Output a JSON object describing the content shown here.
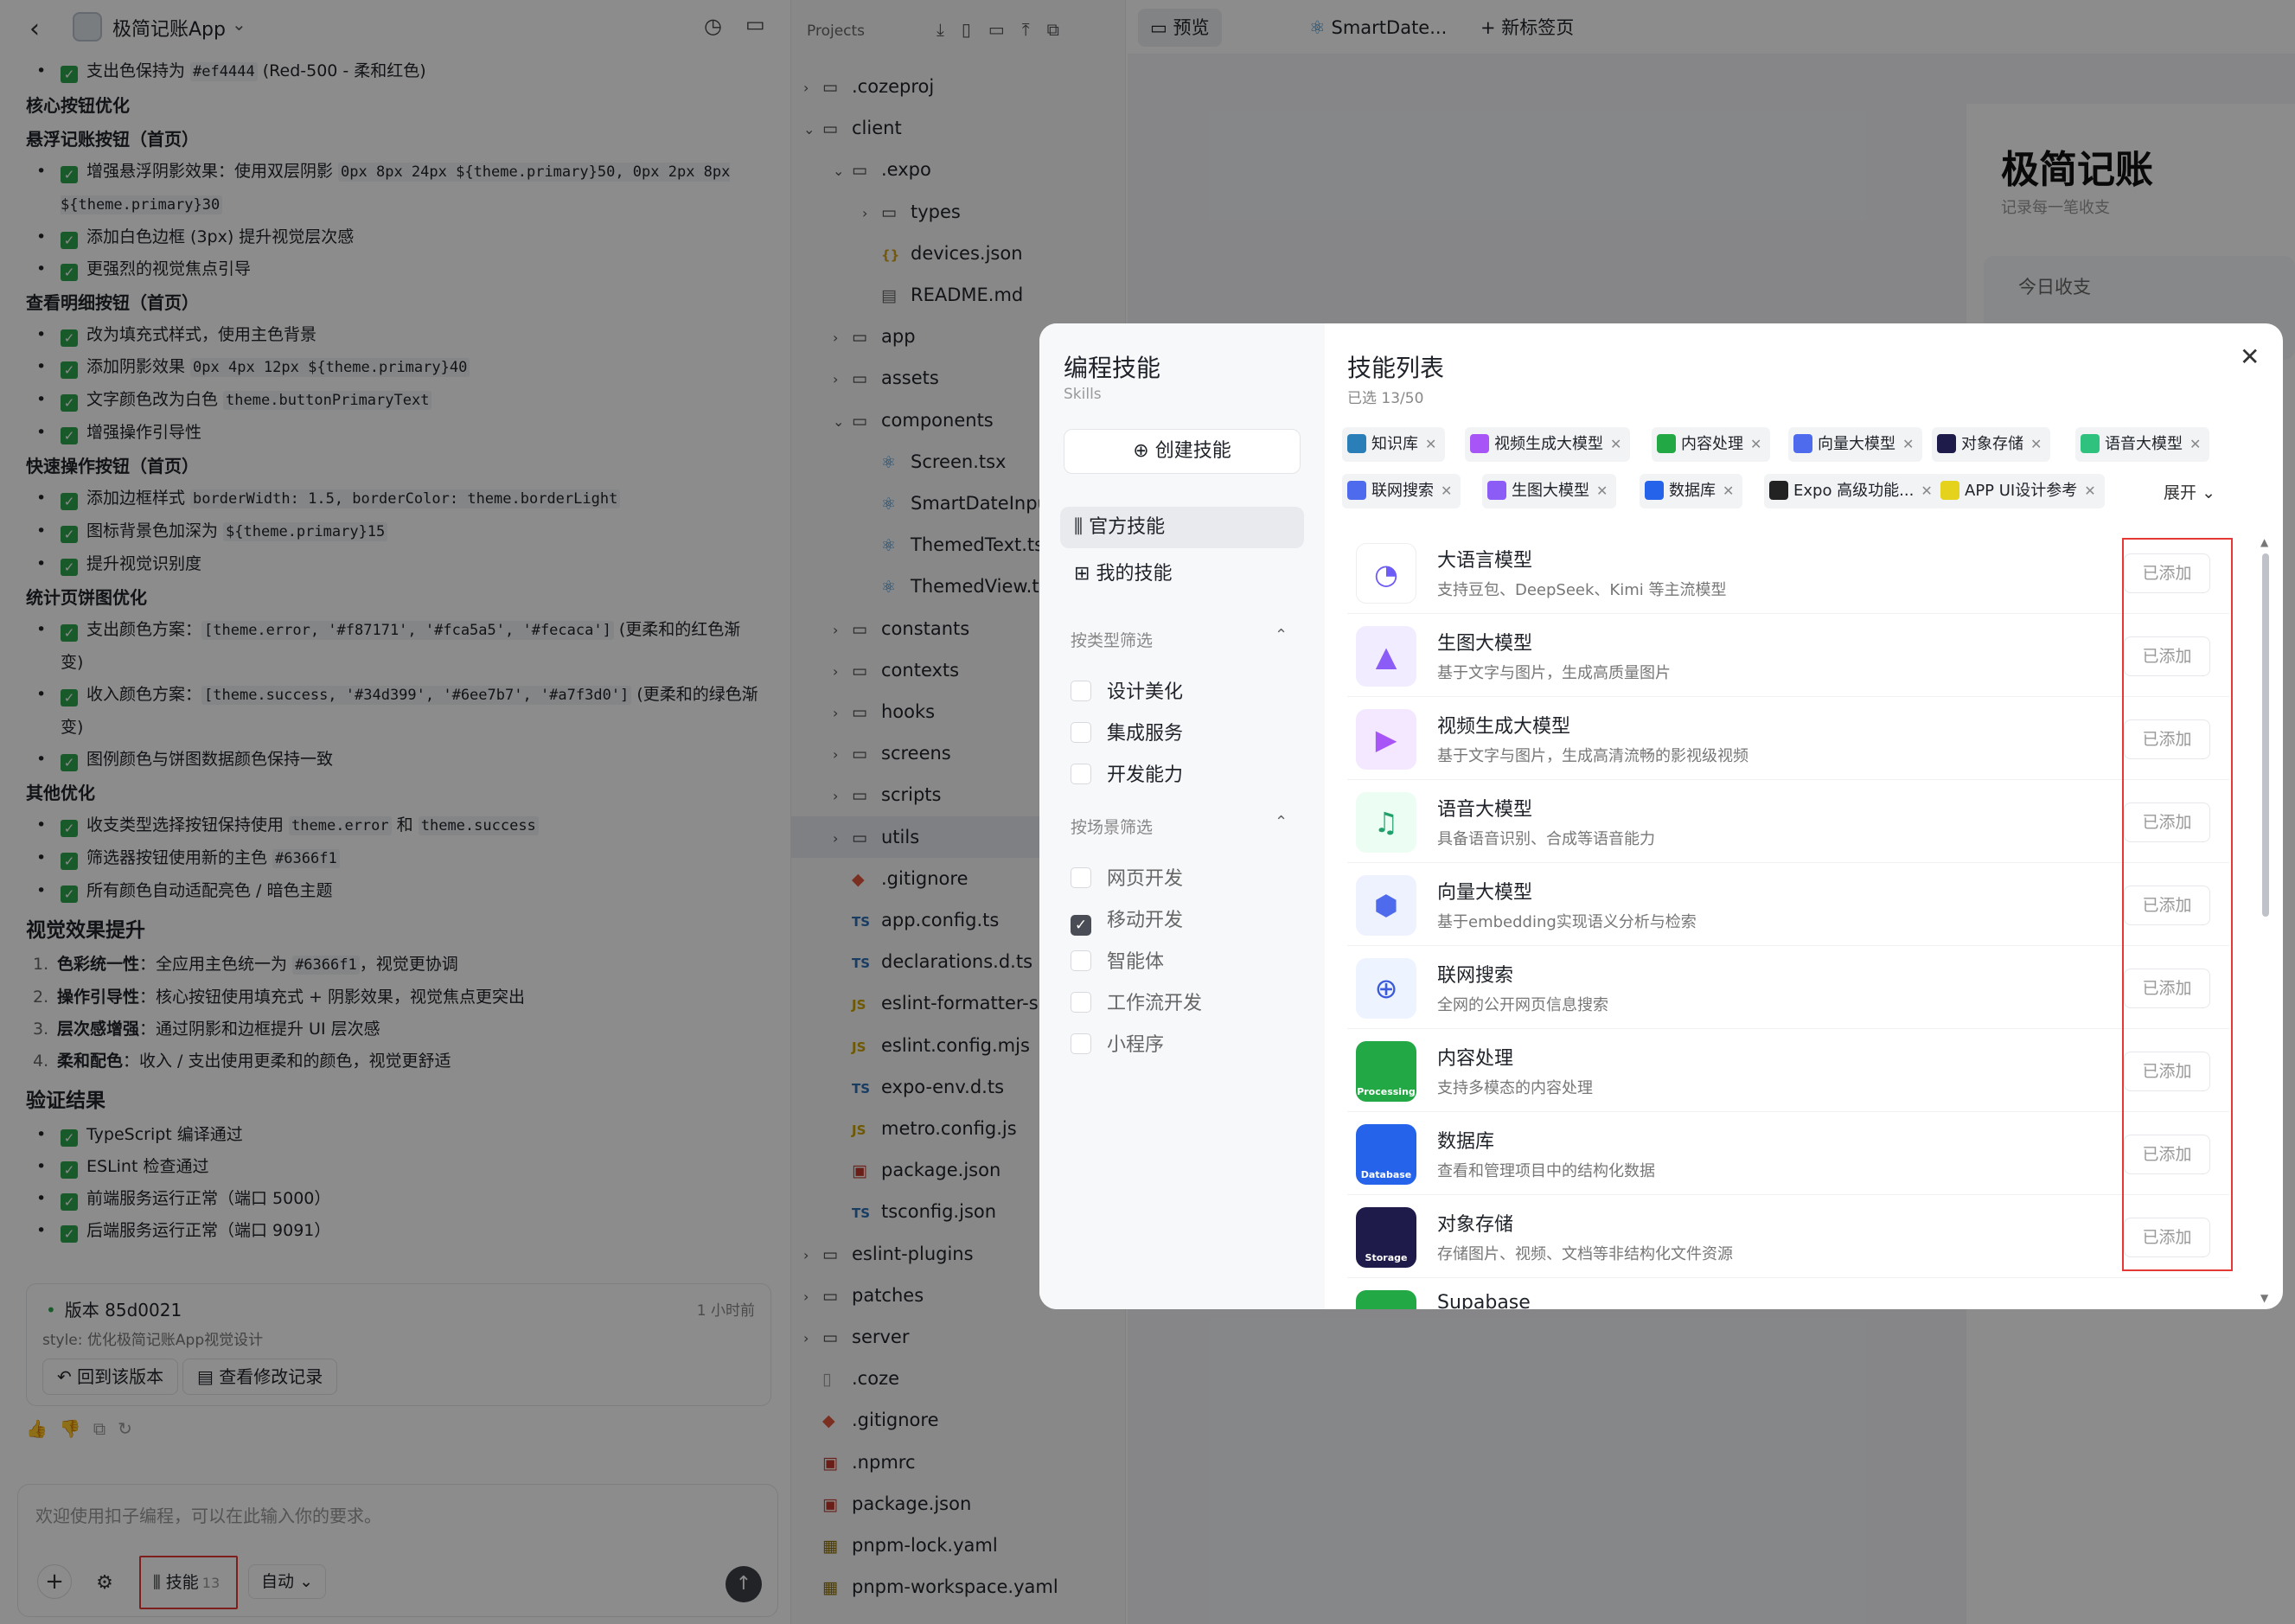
{
  "chat": {
    "app_title": "极简记账App",
    "sections": [
      {
        "type": "li",
        "text_before": "支出色保持为 ",
        "code": "#ef4444",
        "text_after": " (Red-500 - 柔和红色)"
      },
      {
        "type": "h4",
        "text": "核心按钮优化"
      },
      {
        "type": "h4",
        "text": "悬浮记账按钮（首页）"
      },
      {
        "type": "li",
        "text_before": "增强悬浮阴影效果：使用双层阴影 ",
        "code": "0px 8px 24px ${theme.primary}50, 0px 2px 8px ${theme.primary}30",
        "text_after": ""
      },
      {
        "type": "li",
        "text_before": "添加白色边框 (3px) 提升视觉层次感",
        "code": "",
        "text_after": ""
      },
      {
        "type": "li",
        "text_before": "更强烈的视觉焦点引导",
        "code": "",
        "text_after": ""
      },
      {
        "type": "h4",
        "text": "查看明细按钮（首页）"
      },
      {
        "type": "li",
        "text_before": "改为填充式样式，使用主色背景",
        "code": "",
        "text_after": ""
      },
      {
        "type": "li",
        "text_before": "添加阴影效果 ",
        "code": "0px 4px 12px ${theme.primary}40",
        "text_after": ""
      },
      {
        "type": "li",
        "text_before": "文字颜色改为白色 ",
        "code": "theme.buttonPrimaryText",
        "text_after": ""
      },
      {
        "type": "li",
        "text_before": "增强操作引导性",
        "code": "",
        "text_after": ""
      },
      {
        "type": "h4",
        "text": "快速操作按钮（首页）"
      },
      {
        "type": "li",
        "text_before": "添加边框样式 ",
        "code": "borderWidth: 1.5, borderColor: theme.borderLight",
        "text_after": ""
      },
      {
        "type": "li",
        "text_before": "图标背景色加深为 ",
        "code": "${theme.primary}15",
        "text_after": ""
      },
      {
        "type": "li",
        "text_before": "提升视觉识别度",
        "code": "",
        "text_after": ""
      },
      {
        "type": "h4",
        "text": "统计页饼图优化"
      },
      {
        "type": "li",
        "text_before": "支出颜色方案：",
        "code": "[theme.error, '#f87171', '#fca5a5', '#fecaca']",
        "text_after": " (更柔和的红色渐变)"
      },
      {
        "type": "li",
        "text_before": "收入颜色方案：",
        "code": "[theme.success, '#34d399', '#6ee7b7', '#a7f3d0']",
        "text_after": " (更柔和的绿色渐变)"
      },
      {
        "type": "li",
        "text_before": "图例颜色与饼图数据颜色保持一致",
        "code": "",
        "text_after": ""
      },
      {
        "type": "h4",
        "text": "其他优化"
      },
      {
        "type": "li",
        "text_before": "收支类型选择按钮保持使用 ",
        "code": "theme.error",
        "text_after": " 和 ",
        "code2": "theme.success"
      },
      {
        "type": "li",
        "text_before": "筛选器按钮使用新的主色 ",
        "code": "#6366f1",
        "text_after": ""
      },
      {
        "type": "li",
        "text_before": "所有颜色自动适配亮色 / 暗色主题",
        "code": "",
        "text_after": ""
      },
      {
        "type": "h3",
        "text": "视觉效果提升"
      },
      {
        "type": "oli",
        "num": "1.",
        "bold": "色彩统一性",
        "text_before": "：全应用主色统一为 ",
        "code": "#6366f1",
        "text_after": "，视觉更协调"
      },
      {
        "type": "oli",
        "num": "2.",
        "bold": "操作引导性",
        "text_before": "：核心按钮使用填充式 + 阴影效果，视觉焦点更突出",
        "code": "",
        "text_after": ""
      },
      {
        "type": "oli",
        "num": "3.",
        "bold": "层次感增强",
        "text_before": "：通过阴影和边框提升 UI 层次感",
        "code": "",
        "text_after": ""
      },
      {
        "type": "oli",
        "num": "4.",
        "bold": "柔和配色",
        "text_before": "：收入 / 支出使用更柔和的颜色，视觉更舒适",
        "code": "",
        "text_after": ""
      },
      {
        "type": "h3",
        "text": "验证结果"
      },
      {
        "type": "li",
        "text_before": "TypeScript 编译通过",
        "code": "",
        "text_after": ""
      },
      {
        "type": "li",
        "text_before": "ESLint 检查通过",
        "code": "",
        "text_after": ""
      },
      {
        "type": "li",
        "text_before": "前端服务运行正常（端口 5000）",
        "code": "",
        "text_after": ""
      },
      {
        "type": "li",
        "text_before": "后端服务运行正常（端口 9091）",
        "code": "",
        "text_after": ""
      }
    ],
    "version": {
      "title": "版本 85d0021",
      "time": "1 小时前",
      "message": "style: 优化极简记账App视觉设计",
      "revert_label": "回到该版本",
      "view_changes_label": "查看修改记录"
    },
    "composer": {
      "placeholder": "欢迎使用扣子编程，可以在此输入你的要求。",
      "skills_label": "技能",
      "skills_count": "13",
      "mode_label": "自动"
    }
  },
  "tree": {
    "title": "Projects",
    "nodes": [
      {
        "label": ".cozeproj",
        "kind": "folder",
        "level": 0,
        "arrow": "›"
      },
      {
        "label": "client",
        "kind": "folder",
        "level": 0,
        "arrow": "⌄"
      },
      {
        "label": ".expo",
        "kind": "folder",
        "level": 1,
        "arrow": "⌄"
      },
      {
        "label": "types",
        "kind": "folder",
        "level": 2,
        "arrow": "›"
      },
      {
        "label": "devices.json",
        "kind": "json",
        "level": 2,
        "arrow": ""
      },
      {
        "label": "README.md",
        "kind": "md",
        "level": 2,
        "arrow": ""
      },
      {
        "label": "app",
        "kind": "folder",
        "level": 1,
        "arrow": "›"
      },
      {
        "label": "assets",
        "kind": "folder",
        "level": 1,
        "arrow": "›"
      },
      {
        "label": "components",
        "kind": "folder",
        "level": 1,
        "arrow": "⌄"
      },
      {
        "label": "Screen.tsx",
        "kind": "react",
        "level": 2,
        "arrow": ""
      },
      {
        "label": "SmartDateInput",
        "kind": "react",
        "level": 2,
        "arrow": ""
      },
      {
        "label": "ThemedText.tsx",
        "kind": "react",
        "level": 2,
        "arrow": ""
      },
      {
        "label": "ThemedView.tsx",
        "kind": "react",
        "level": 2,
        "arrow": ""
      },
      {
        "label": "constants",
        "kind": "folder",
        "level": 1,
        "arrow": "›"
      },
      {
        "label": "contexts",
        "kind": "folder",
        "level": 1,
        "arrow": "›"
      },
      {
        "label": "hooks",
        "kind": "folder",
        "level": 1,
        "arrow": "›"
      },
      {
        "label": "screens",
        "kind": "folder",
        "level": 1,
        "arrow": "›"
      },
      {
        "label": "scripts",
        "kind": "folder",
        "level": 1,
        "arrow": "›"
      },
      {
        "label": "utils",
        "kind": "folder",
        "level": 1,
        "arrow": "›",
        "highlight": true
      },
      {
        "label": ".gitignore",
        "kind": "git",
        "level": 1,
        "arrow": ""
      },
      {
        "label": "app.config.ts",
        "kind": "ts",
        "level": 1,
        "arrow": ""
      },
      {
        "label": "declarations.d.ts",
        "kind": "ts",
        "level": 1,
        "arrow": ""
      },
      {
        "label": "eslint-formatter-simple",
        "kind": "js",
        "level": 1,
        "arrow": ""
      },
      {
        "label": "eslint.config.mjs",
        "kind": "js",
        "level": 1,
        "arrow": ""
      },
      {
        "label": "expo-env.d.ts",
        "kind": "ts",
        "level": 1,
        "arrow": ""
      },
      {
        "label": "metro.config.js",
        "kind": "js",
        "level": 1,
        "arrow": ""
      },
      {
        "label": "package.json",
        "kind": "npm",
        "level": 1,
        "arrow": ""
      },
      {
        "label": "tsconfig.json",
        "kind": "ts",
        "level": 1,
        "arrow": ""
      },
      {
        "label": "eslint-plugins",
        "kind": "folder",
        "level": 0,
        "arrow": "›"
      },
      {
        "label": "patches",
        "kind": "folder",
        "level": 0,
        "arrow": "›"
      },
      {
        "label": "server",
        "kind": "folder",
        "level": 0,
        "arrow": "›"
      },
      {
        "label": ".coze",
        "kind": "file",
        "level": 0,
        "arrow": ""
      },
      {
        "label": ".gitignore",
        "kind": "git",
        "level": 0,
        "arrow": ""
      },
      {
        "label": ".npmrc",
        "kind": "npm",
        "level": 0,
        "arrow": ""
      },
      {
        "label": "package.json",
        "kind": "npm",
        "level": 0,
        "arrow": ""
      },
      {
        "label": "pnpm-lock.yaml",
        "kind": "yaml",
        "level": 0,
        "arrow": ""
      },
      {
        "label": "pnpm-workspace.yaml",
        "kind": "yaml",
        "level": 0,
        "arrow": ""
      }
    ]
  },
  "tabs": [
    {
      "label": "预览",
      "icon": "preview-icon",
      "active": true
    },
    {
      "label": "SmartDate...",
      "icon": "react-icon",
      "active": false
    },
    {
      "label": "新标签页",
      "icon": "plus-icon",
      "active": false
    }
  ],
  "preview": {
    "title": "极简记账",
    "subtitle": "记录每一笔收支",
    "card_label": "今日收支"
  },
  "modal": {
    "side_title": "编程技能",
    "side_subtitle": "Skills",
    "create_label": "创建技能",
    "nav": [
      {
        "label": "官方技能",
        "icon": "library-icon",
        "active": true
      },
      {
        "label": "我的技能",
        "icon": "my-skill-icon",
        "active": false
      }
    ],
    "type_filter_title": "按类型筛选",
    "type_filters": [
      {
        "label": "设计美化",
        "checked": false
      },
      {
        "label": "集成服务",
        "checked": false
      },
      {
        "label": "开发能力",
        "checked": false
      }
    ],
    "scene_filter_title": "按场景筛选",
    "scene_filters": [
      {
        "label": "网页开发",
        "checked": false
      },
      {
        "label": "移动开发",
        "checked": true
      },
      {
        "label": "智能体",
        "checked": false
      },
      {
        "label": "工作流开发",
        "checked": false
      },
      {
        "label": "小程序",
        "checked": false
      }
    ],
    "main_title": "技能列表",
    "selected_text": "已选 13/50",
    "expand_label": "展开",
    "chips": [
      {
        "label": "知识库",
        "color": "#2b7fb8"
      },
      {
        "label": "视频生成大模型",
        "color": "#a855f7"
      },
      {
        "label": "内容处理",
        "color": "#22a845"
      },
      {
        "label": "向量大模型",
        "color": "#4f6bed"
      },
      {
        "label": "对象存储",
        "color": "#1e1b4b"
      },
      {
        "label": "语音大模型",
        "color": "#2ec27e"
      },
      {
        "label": "联网搜索",
        "color": "#4f6bed"
      },
      {
        "label": "生图大模型",
        "color": "#8b5cf6"
      },
      {
        "label": "数据库",
        "color": "#2563eb"
      },
      {
        "label": "Expo 高级功能...",
        "color": "#222222"
      },
      {
        "label": "APP UI设计参考",
        "color": "#e5d21c"
      }
    ],
    "skills": [
      {
        "name": "大语言模型",
        "desc": "支持豆包、DeepSeek、Kimi 等主流模型",
        "status": "已添加",
        "color": "#ffffff",
        "glyph": "◔",
        "glyph_color": "#6d5cf6"
      },
      {
        "name": "生图大模型",
        "desc": "基于文字与图片，生成高质量图片",
        "status": "已添加",
        "color": "#f1ecff",
        "glyph": "▲",
        "glyph_color": "#8b5cf6"
      },
      {
        "name": "视频生成大模型",
        "desc": "基于文字与图片，生成高清流畅的影视级视频",
        "status": "已添加",
        "color": "#f3e8ff",
        "glyph": "▶",
        "glyph_color": "#a855f7"
      },
      {
        "name": "语音大模型",
        "desc": "具备语音识别、合成等语音能力",
        "status": "已添加",
        "color": "#ecfdf3",
        "glyph": "♫",
        "glyph_color": "#22a06b"
      },
      {
        "name": "向量大模型",
        "desc": "基于embedding实现语义分析与检索",
        "status": "已添加",
        "color": "#eef2ff",
        "glyph": "⬢",
        "glyph_color": "#4f6bed"
      },
      {
        "name": "联网搜索",
        "desc": "全网的公开网页信息搜索",
        "status": "已添加",
        "color": "#eef4ff",
        "glyph": "⊕",
        "glyph_color": "#3b5bdb"
      },
      {
        "name": "内容处理",
        "desc": "支持多模态的内容处理",
        "status": "已添加",
        "color": "#22a845",
        "glyph": "Processing",
        "glyph_color": "#ffffff"
      },
      {
        "name": "数据库",
        "desc": "查看和管理项目中的结构化数据",
        "status": "已添加",
        "color": "#2563eb",
        "glyph": "Database",
        "glyph_color": "#ffffff"
      },
      {
        "name": "对象存储",
        "desc": "存储图片、视频、文档等非结构化文件资源",
        "status": "已添加",
        "color": "#1e1b4b",
        "glyph": "Storage",
        "glyph_color": "#ffffff"
      },
      {
        "name": "Supabase",
        "desc": "",
        "status": "",
        "color": "#22a845",
        "glyph": "",
        "glyph_color": "#ffffff"
      }
    ]
  }
}
